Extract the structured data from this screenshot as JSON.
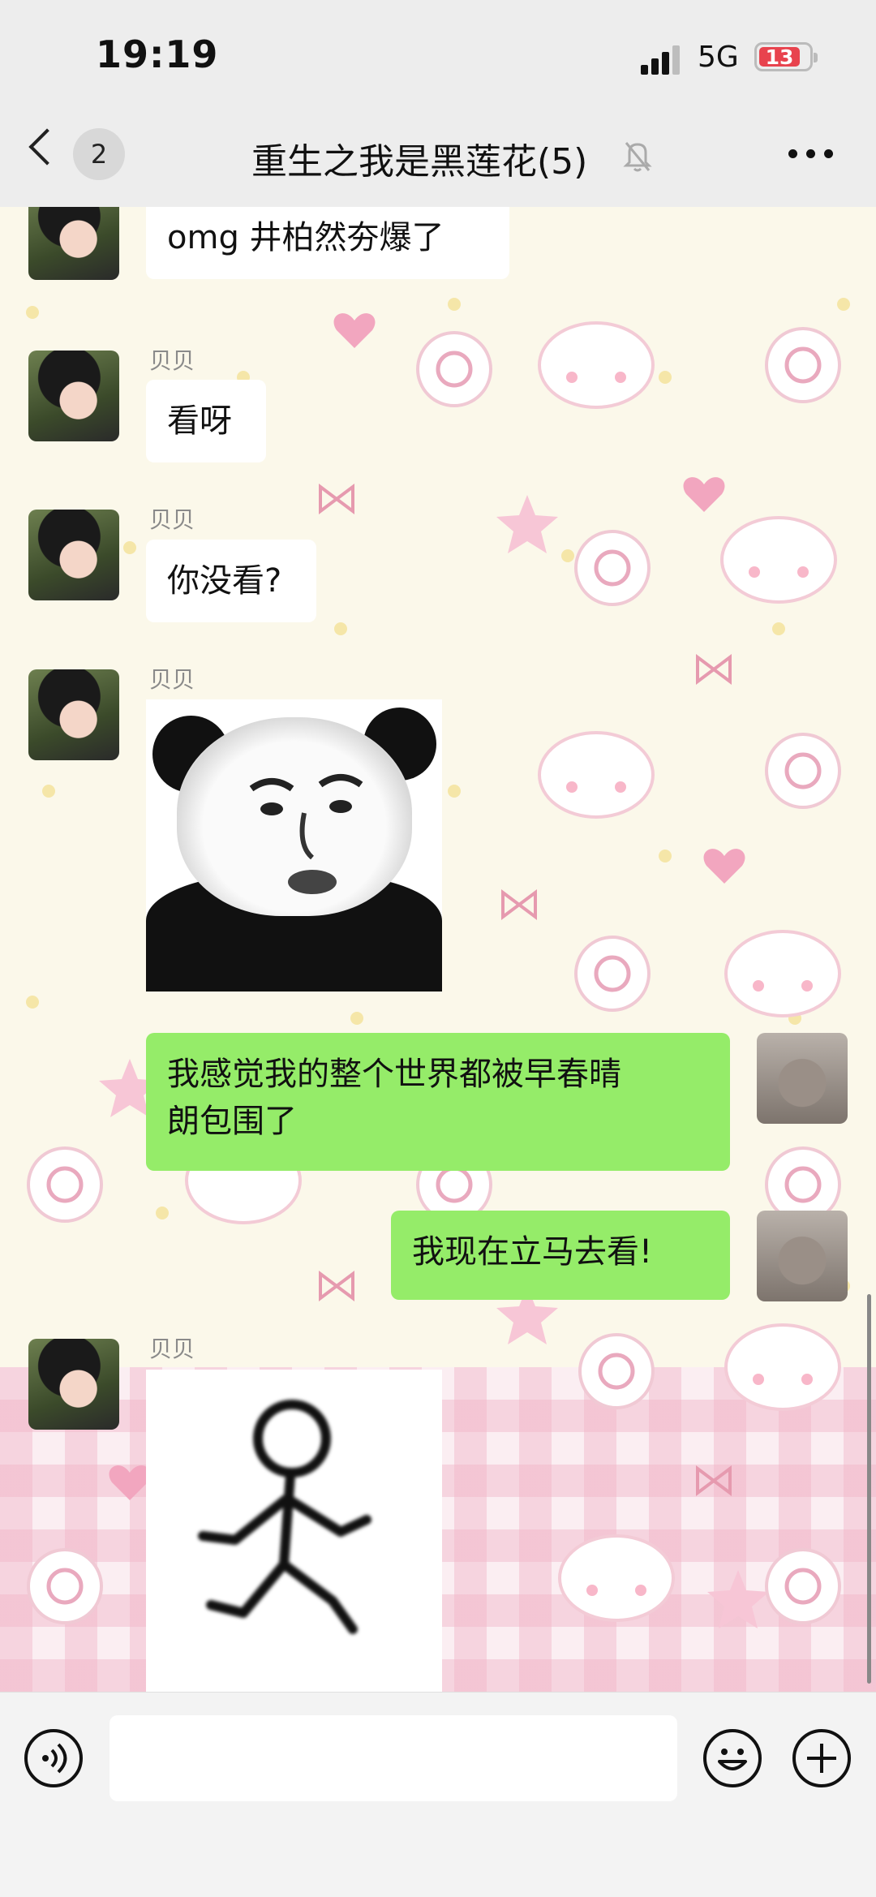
{
  "status_bar": {
    "time": "19:19",
    "network": "5G",
    "battery": "13"
  },
  "header": {
    "unread_count": "2",
    "title": "重生之我是黑莲花(5)"
  },
  "messages": [
    {
      "type": "text",
      "direction": "in",
      "sender": "贝贝",
      "text": "omg 井柏然夯爆了"
    },
    {
      "type": "text",
      "direction": "in",
      "sender": "贝贝",
      "text": "看呀"
    },
    {
      "type": "text",
      "direction": "in",
      "sender": "贝贝",
      "text": "你没看?"
    },
    {
      "type": "sticker",
      "direction": "in",
      "sender": "贝贝",
      "sticker": "panda-face-meme"
    },
    {
      "type": "text",
      "direction": "out",
      "text_line1": "我感觉我的整个世界都被早春晴",
      "text_line2": "朗包围了"
    },
    {
      "type": "text",
      "direction": "out",
      "text": "我现在立马去看!"
    },
    {
      "type": "sticker",
      "direction": "in",
      "sender": "贝贝",
      "sticker": "stick-figure-running"
    }
  ],
  "input_bar": {
    "placeholder": ""
  },
  "icons": {
    "back": "chevron-left-icon",
    "mute": "bell-off-icon",
    "more": "ellipsis-icon",
    "voice": "voice-icon",
    "emoji": "smiley-icon",
    "add": "plus-circle-icon"
  },
  "colors": {
    "outgoing_bubble": "#95ec69",
    "incoming_bubble": "#ffffff",
    "header_bg": "#ededed",
    "chat_bg": "#fbf8ea",
    "battery": "#e8434e"
  }
}
